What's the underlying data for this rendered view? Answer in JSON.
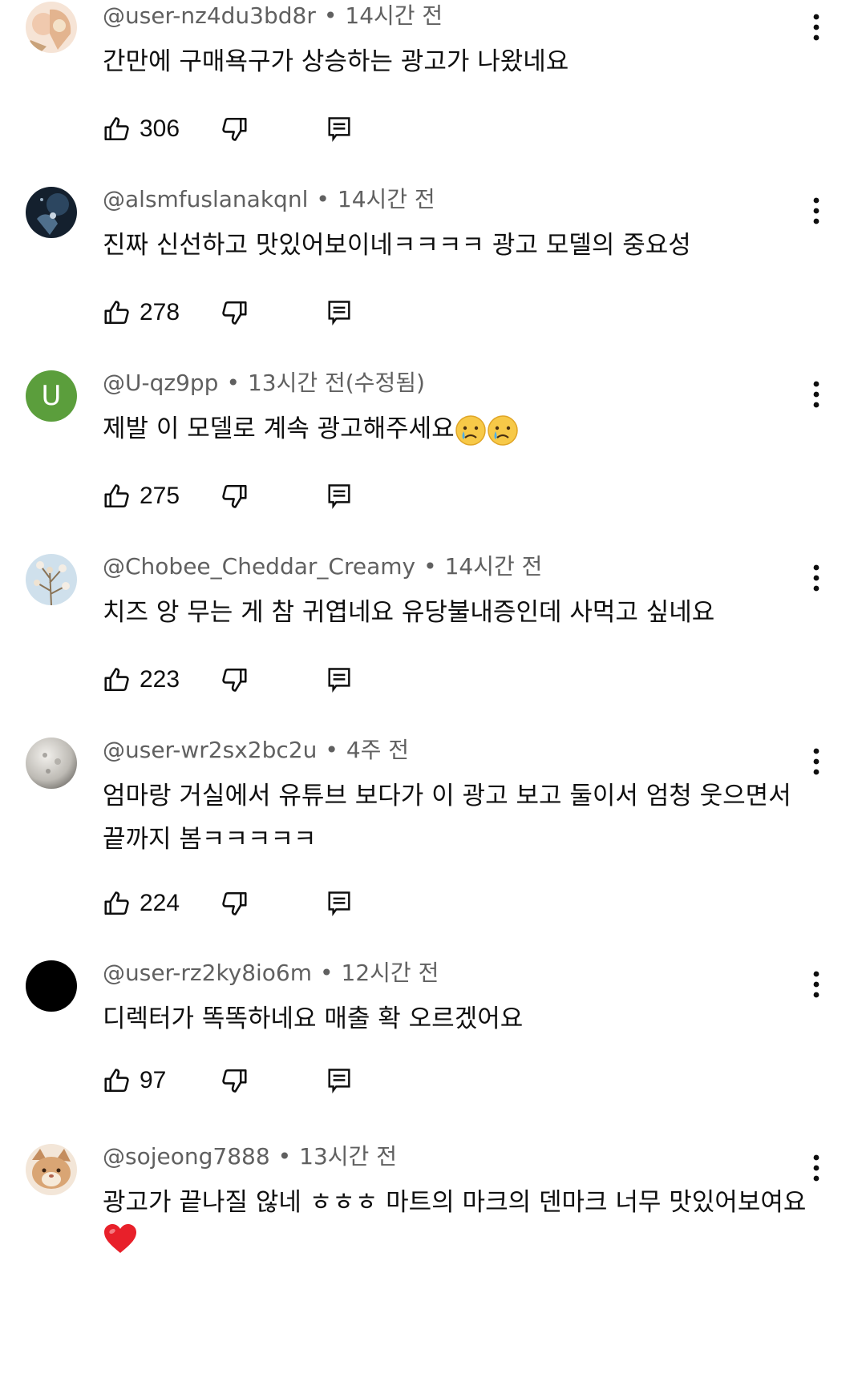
{
  "comments": [
    {
      "author": "@user-nz4du3bd8r",
      "time": "14시간 전",
      "text": "간만에 구매욕구가 상승하는 광고가 나왔네요",
      "likes": "306",
      "avatar": {
        "type": "image",
        "colors": [
          "#f3d9c8",
          "#e6b89e",
          "#c9a27a"
        ]
      }
    },
    {
      "author": "@alsmfuslanakqnl",
      "time": "14시간 전",
      "text": "진짜 신선하고 맛있어보이네ㅋㅋㅋㅋ 광고 모델의 중요성",
      "likes": "278",
      "avatar": {
        "type": "image",
        "colors": [
          "#1c2a3a",
          "#3d5872",
          "#0c141e"
        ]
      }
    },
    {
      "author": "@U-qz9pp",
      "time": "13시간 전(수정됨)",
      "text": "제발 이 모델로 계속 광고해주세요",
      "emoji": [
        "crying-face",
        "crying-face"
      ],
      "likes": "275",
      "avatar": {
        "type": "letter",
        "letter": "U",
        "color": "#5b9e3c"
      }
    },
    {
      "author": "@Chobee_Cheddar_Creamy",
      "time": "14시간 전",
      "text": "치즈 앙 무는 게 참 귀엽네요 유당불내증인데 사먹고 싶네요",
      "likes": "223",
      "avatar": {
        "type": "image",
        "colors": [
          "#dbe6ee",
          "#c9b79c",
          "#a9c3d6"
        ]
      }
    },
    {
      "author": "@user-wr2sx2bc2u",
      "time": "4주 전",
      "text": "엄마랑 거실에서 유튜브 보다가 이 광고 보고 둘이서 엄청 웃으면서\n끝까지 봄ㅋㅋㅋㅋㅋ",
      "likes": "224",
      "avatar": {
        "type": "image",
        "colors": [
          "#e8e6e2",
          "#b9b6b0",
          "#8d8a85"
        ]
      }
    },
    {
      "author": "@user-rz2ky8io6m",
      "time": "12시간 전",
      "text": "디렉터가 똑똑하네요 매출 확 오르겠어요",
      "likes": "97",
      "avatar": {
        "type": "image",
        "colors": [
          "#000000",
          "#000000",
          "#000000"
        ]
      }
    },
    {
      "author": "@sojeong7888",
      "time": "13시간 전",
      "text": "광고가 끝나질 않네 ㅎㅎㅎ 마트의 마크의 덴마크 너무 맛있어보여요",
      "emoji_next_line": "red-heart",
      "avatar": {
        "type": "image",
        "colors": [
          "#e9c9a6",
          "#c48d5e",
          "#f5e6d6"
        ]
      }
    }
  ],
  "icons": {
    "like": "thumbs-up-icon",
    "dislike": "thumbs-down-icon",
    "reply": "reply-icon",
    "more": "more-vert-icon"
  },
  "colors": {
    "text": "#0f0f0f",
    "meta": "#606060",
    "heart": "#e8202a"
  }
}
